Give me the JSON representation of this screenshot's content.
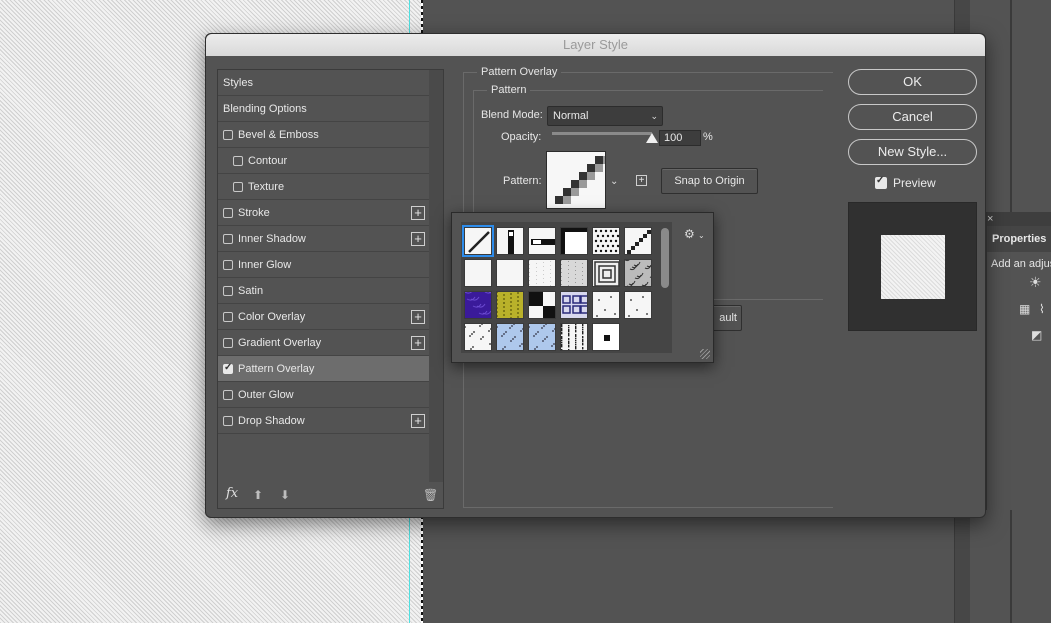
{
  "dialog": {
    "title": "Layer Style"
  },
  "styles_list": {
    "header": "Styles",
    "items": [
      {
        "label": "Blending Options",
        "checkbox": false,
        "checked": false,
        "plus": false,
        "indent": false
      },
      {
        "label": "Bevel & Emboss",
        "checkbox": true,
        "checked": false,
        "plus": false,
        "indent": false
      },
      {
        "label": "Contour",
        "checkbox": true,
        "checked": false,
        "plus": false,
        "indent": true
      },
      {
        "label": "Texture",
        "checkbox": true,
        "checked": false,
        "plus": false,
        "indent": true
      },
      {
        "label": "Stroke",
        "checkbox": true,
        "checked": false,
        "plus": true,
        "indent": false
      },
      {
        "label": "Inner Shadow",
        "checkbox": true,
        "checked": false,
        "plus": true,
        "indent": false
      },
      {
        "label": "Inner Glow",
        "checkbox": true,
        "checked": false,
        "plus": false,
        "indent": false
      },
      {
        "label": "Satin",
        "checkbox": true,
        "checked": false,
        "plus": false,
        "indent": false
      },
      {
        "label": "Color Overlay",
        "checkbox": true,
        "checked": false,
        "plus": true,
        "indent": false
      },
      {
        "label": "Gradient Overlay",
        "checkbox": true,
        "checked": false,
        "plus": true,
        "indent": false
      },
      {
        "label": "Pattern Overlay",
        "checkbox": true,
        "checked": true,
        "plus": false,
        "indent": false,
        "selected": true
      },
      {
        "label": "Outer Glow",
        "checkbox": true,
        "checked": false,
        "plus": false,
        "indent": false
      },
      {
        "label": "Drop Shadow",
        "checkbox": true,
        "checked": false,
        "plus": true,
        "indent": false
      }
    ],
    "footer_icons": [
      "fx-icon",
      "move-up-icon",
      "move-down-icon",
      "trash-icon"
    ]
  },
  "pattern_overlay": {
    "section_title": "Pattern Overlay",
    "group_title": "Pattern",
    "blend_mode_label": "Blend Mode:",
    "blend_mode_value": "Normal",
    "opacity_label": "Opacity:",
    "opacity_value": "100",
    "opacity_unit": "%",
    "opacity_fraction": 1.0,
    "pattern_label": "Pattern:",
    "snap_button": "Snap to Origin",
    "default_button_partial": "ault"
  },
  "buttons": {
    "ok": "OK",
    "cancel": "Cancel",
    "new_style": "New Style...",
    "preview_label": "Preview",
    "preview_checked": true
  },
  "properties_panel": {
    "title": "Properties",
    "subtitle": "Add an adjus"
  },
  "pattern_picker": {
    "selected_index": 0,
    "tiles": [
      "diagonal-line-pattern",
      "vertical-bar-pattern",
      "horizontal-bar-pattern",
      "black-corner-pattern",
      "dot-grid-pattern",
      "diagonal-steps-pattern",
      "white-pattern",
      "white-pattern",
      "light-noise-pattern",
      "grey-noise-pattern",
      "concentric-squares-pattern",
      "marble-pattern",
      "purple-texture-pattern",
      "yellow-texture-pattern",
      "checker-pattern",
      "blue-weave-pattern",
      "sparse-dots-pattern",
      "sparse-dots-pattern",
      "speckle-pattern",
      "light-blue-speckle-pattern",
      "light-blue-speckle-pattern",
      "dense-speckle-pattern",
      "single-dot-pattern"
    ]
  }
}
